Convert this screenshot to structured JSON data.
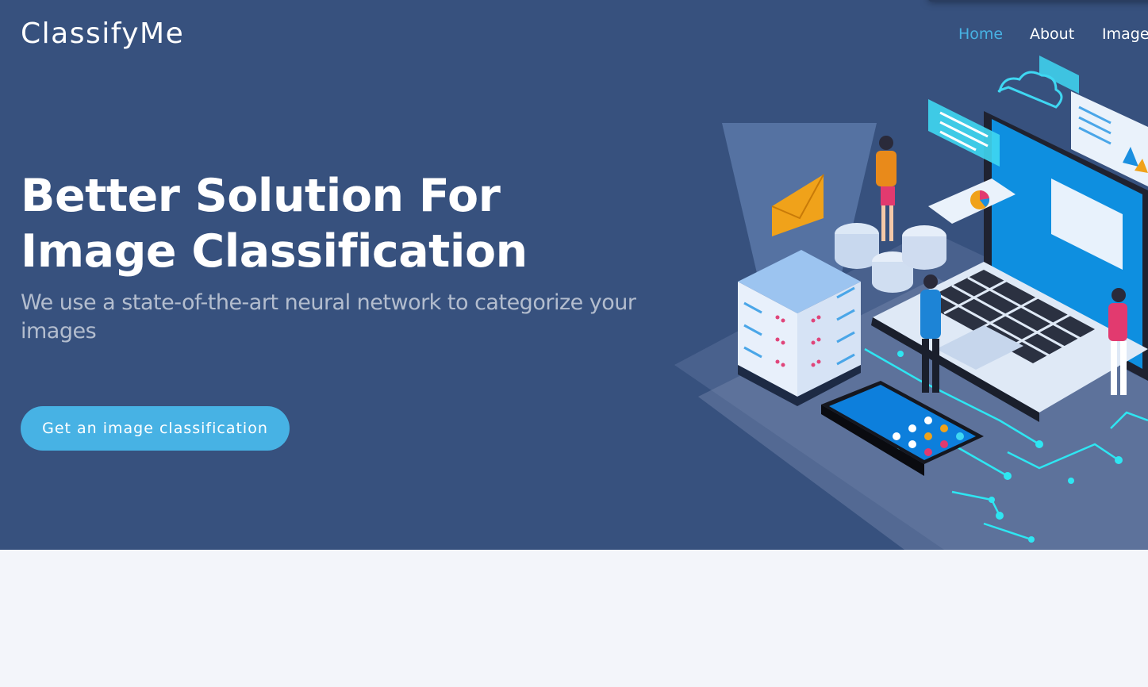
{
  "brand": {
    "logo_text": "ClassifyMe"
  },
  "nav": {
    "items": [
      {
        "label": "Home",
        "active": true
      },
      {
        "label": "About",
        "active": false
      },
      {
        "label": "Image",
        "active": false
      }
    ]
  },
  "hero": {
    "title": "Better Solution For Image Classification",
    "subtitle": "We use a state-of-the-art neural network to categorize your images",
    "cta_label": "Get an image classification",
    "illustration_icon": "isometric-tech-illustration-icon"
  },
  "colors": {
    "hero_background": "#37517e",
    "accent": "#47b2e4",
    "page_background": "#f3f5fa"
  }
}
